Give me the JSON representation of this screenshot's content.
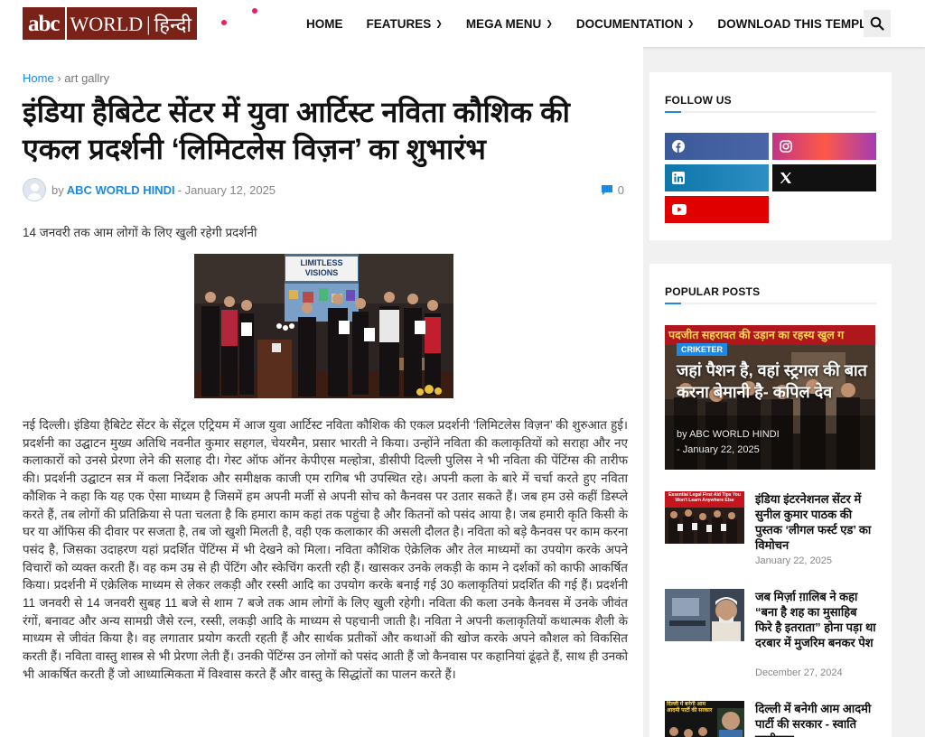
{
  "header": {
    "logo_abc": "abc",
    "logo_world": "WORLD",
    "logo_hindi": "हिन्दी",
    "nav": [
      {
        "label": "HOME",
        "dropdown": false
      },
      {
        "label": "FEATURES",
        "dropdown": true
      },
      {
        "label": "MEGA MENU",
        "dropdown": true
      },
      {
        "label": "DOCUMENTATION",
        "dropdown": true
      },
      {
        "label": "DOWNLOAD THIS TEMPLATE",
        "dropdown": false
      }
    ],
    "search_icon": "search-icon",
    "brand_color": "#7a2118"
  },
  "article": {
    "breadcrumb_home": "Home",
    "breadcrumb_sep": "›",
    "breadcrumb_current": "art gallry",
    "title": "इंडिया हैबिटेट सेंटर में युवा आर्टिस्ट नविता कौशिक की एकल प्रदर्शनी ‘लिमिटलेस विज़न’ का शुभारंभ",
    "by": "by",
    "author": "ABC WORLD HINDI",
    "date": "- January 12, 2025",
    "comment_count": "0",
    "subtitle": "14 जनवरी तक आम लोगों के लिए खुली रहेगी प्रदर्शनी",
    "photo_banner": "LIMITLESS VISIONS",
    "body": "नई दिल्ली। इंडिया हैबिटेट सेंटर के सेंट्रल एट्रियम में आज युवा आर्टिस्ट नविता कौशिक की एकल प्रदर्शनी ‘लिमिटलेस विज़न’ की शुरुआत हुई। प्रदर्शनी का उद्घाटन मुख्य अतिथि नवनीत कुमार सहगल, चेयरमैन, प्रसार भारती ने किया। उन्होंने नविता की कलाकृतियों को सराहा और नए कलाकारों को उनसे प्रेरणा लेने की सलाह दी। गेस्ट ऑफ ऑनर केपीएस मल्होत्रा, डीसीपी दिल्ली पुलिस ने भी नविता की पेंटिंग्स की तारीफ की। प्रदर्शनी उद्घाटन सत्र में कला निर्देशक और समीक्षक काजी एम रागिब भी उपस्थित रहे। अपनी कला के बारे में चर्चा करते हुए नविता कौशिक ने कहा कि यह एक ऐसा माध्यम है जिसमें हम अपनी मर्जी से अपनी सोच को कैनवस पर उतार सकते हैं। जब हम उसे कहीं डिस्प्ले करते हैं, तब लोगों की प्रतिक्रिया से पता चलता है कि हमारा काम कहां तक पहुंचा है और कितनों को पसंद आया है। जब हमारी कृति किसी के घर या ऑफिस की दीवार पर सजता है, तब जो खुशी मिलती है, वही एक कलाकार की असली दौलत है। नविता को बड़े कैनवस पर काम करना पसंद है, जिसका उदाहरण यहां प्रदर्शित पेंटिंग्स में भी देखने को मिला। नविता कौशिक ऐक्रेलिक और तेल माध्यमों का उपयोग करके अपने विचारों को व्यक्त करती हैं। वह कम उम्र से ही पेंटिंग और स्केचिंग करती रही हैं। खासकर उनके लकड़ी के काम ने दर्शकों को काफी आकर्षित किया। प्रदर्शनी में एक्रेलिक माध्यम से लेकर लकड़ी और रस्सी आदि का उपयोग करके बनाई गई 30 कलाकृतियां प्रदर्शित की गई हैं। प्रदर्शनी 11 जनवरी से 14 जनवरी सुबह 11 बजे से शाम 7 बजे तक आम लोगों के लिए खुली रहेगी। नविता की कला उनके कैनवस में उनके जीवंत रंगों, बनावट और अन्य सामग्री जैसे रत्न, रस्सी, लकड़ी आदि के माध्यम से पहचानी जाती है। नविता ने अपनी कलाकृतियों कथात्मक शैली के माध्यम से जीवंत किया है। वह लगातार प्रयोग करती रहती हैं और सार्थक प्रतीकों और कथाओं की खोज करके अपने कौशल को विकसित करती हैं। नविता वास्तु शास्त्र से भी प्रेरणा लेती हैं। उनकी पेंटिंग्स उन लोगों को पसंद आती हैं जो कैनवास पर कहानियां ढूंढ़ते हैं, साथ ही उनको भी आकर्षित करती हैं जो आध्यात्मिकता में विश्वास करते हैं और वास्तु के सिद्धांतों का पालन करते हैं।"
  },
  "sidebar": {
    "follow_title": "FOLLOW US",
    "social": [
      {
        "name": "facebook",
        "icon": "facebook-icon",
        "color": "#3b5998"
      },
      {
        "name": "instagram",
        "icon": "instagram-icon",
        "color": "#c13584"
      },
      {
        "name": "linkedin",
        "icon": "linkedin-icon",
        "color": "#0e76a8"
      },
      {
        "name": "x",
        "icon": "x-icon",
        "color": "#111111"
      },
      {
        "name": "youtube",
        "icon": "youtube-icon",
        "color": "#e10000"
      }
    ],
    "popular_title": "POPULAR POSTS",
    "featured": {
      "banner": "पदजीत सहरावत की उड़ान का रहस्य खुल ग",
      "tag": "CRIKETER",
      "title": "जहां पैशन है, वहां स्ट्रगल की बात करना बेमानी है- कपिल देव",
      "author": "by ABC WORLD HINDI",
      "date": "- January 22, 2025"
    },
    "posts": [
      {
        "title": "इंडिया इंटरनेशनल सेंटर में सुनील कुमार पाठक की पुस्तक ‘लीगल फर्स्ट एड’ का विमोचन",
        "date": "January 22, 2025"
      },
      {
        "title": "जब मिर्ज़ा ग़ालिब ने कहा “बना है शह का मुसाहिब फिरे है इतराता” होना पड़ा था दरबार में मुजरिम बनकर पेश",
        "date": "December 27, 2024"
      },
      {
        "title": "दिल्ली में बनेगी आम आदमी पार्टी की सरकार - स्वाति मालीवाल",
        "date": ""
      }
    ],
    "thumb1_text": "Essential Legal First Aid Tips You Won't Learn Anywhere Else",
    "thumb3_text": "दिल्ली में बनेगी आम आदमी पार्टी की सरकार"
  }
}
